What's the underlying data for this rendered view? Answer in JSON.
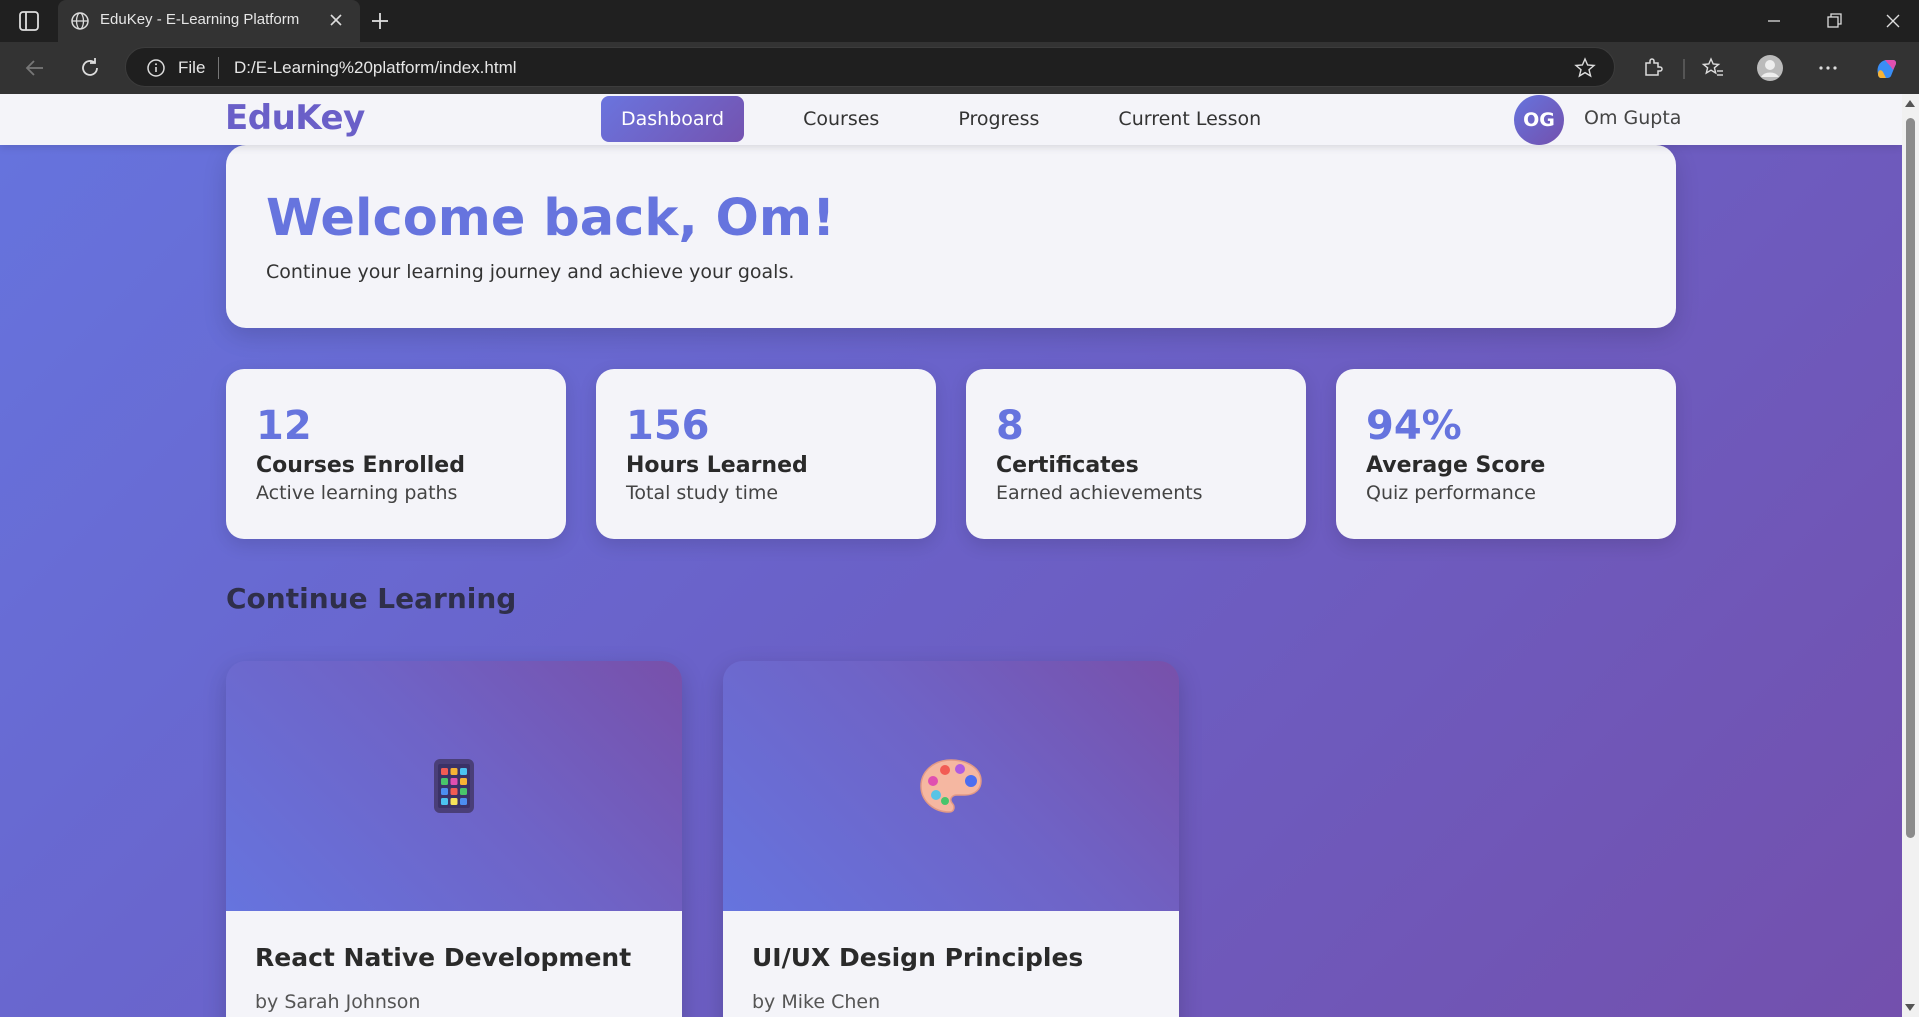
{
  "browser": {
    "tab_title": "EduKey - E-Learning Platform",
    "address_scheme": "File",
    "address_url": "D:/E-Learning%20platform/index.html"
  },
  "site": {
    "logo": "EduKey",
    "nav": [
      {
        "label": "Dashboard",
        "active": true
      },
      {
        "label": "Courses",
        "active": false
      },
      {
        "label": "Progress",
        "active": false
      },
      {
        "label": "Current Lesson",
        "active": false
      }
    ],
    "user": {
      "initials": "OG",
      "name": "Om Gupta"
    }
  },
  "welcome": {
    "heading": "Welcome back, Om!",
    "subtitle": "Continue your learning journey and achieve your goals."
  },
  "stats": [
    {
      "value": "12",
      "label": "Courses Enrolled",
      "sub": "Active learning paths"
    },
    {
      "value": "156",
      "label": "Hours Learned",
      "sub": "Total study time"
    },
    {
      "value": "8",
      "label": "Certificates",
      "sub": "Earned achievements"
    },
    {
      "value": "94%",
      "label": "Average Score",
      "sub": "Quiz performance"
    }
  ],
  "continue_learning": {
    "title": "Continue Learning",
    "courses": [
      {
        "icon": "mobile-app-icon",
        "title": "React Native Development",
        "instructor": "by Sarah Johnson"
      },
      {
        "icon": "palette-icon",
        "title": "UI/UX Design Principles",
        "instructor": "by Mike Chen"
      }
    ]
  },
  "colors": {
    "accent": "#6674de",
    "accent_dark": "#7350ad",
    "card_bg": "#f4f4f9"
  }
}
